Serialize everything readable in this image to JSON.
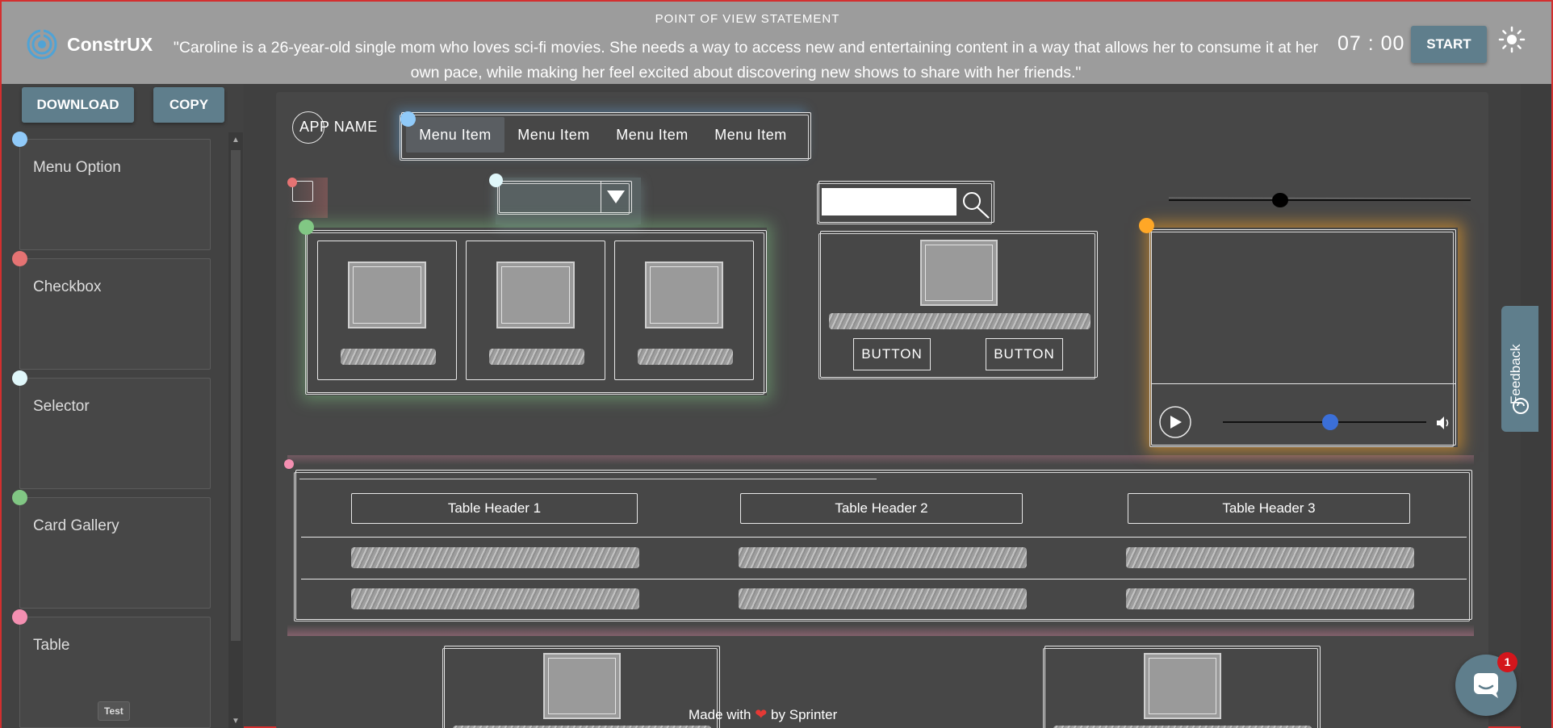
{
  "header": {
    "app_name": "ConstrUX",
    "pov_label": "POINT OF VIEW STATEMENT",
    "pov_text": "\"Caroline is a 26-year-old single mom who loves sci-fi movies. She needs a way to access new and entertaining content in a way that allows her to consume it at her own pace, while making her feel excited about discovering new shows to share with her friends.\"",
    "timer": "07 : 00",
    "start_label": "START",
    "theme_icon": "sun-icon"
  },
  "sidebar": {
    "download_label": "DOWNLOAD",
    "copy_label": "COPY",
    "components": [
      {
        "label": "Menu Option",
        "color": "#90caf9"
      },
      {
        "label": "Checkbox",
        "color": "#e57373"
      },
      {
        "label": "Selector",
        "color": "#e0f7fa"
      },
      {
        "label": "Card Gallery",
        "color": "#81c784"
      },
      {
        "label": "Table",
        "color": "#f48fb1"
      }
    ],
    "test_label": "Test"
  },
  "canvas": {
    "app_name": "APP NAME",
    "menu_items": [
      "Menu Item",
      "Menu Item",
      "Menu Item",
      "Menu Item"
    ],
    "buttons": [
      "BUTTON",
      "BUTTON"
    ],
    "table_headers": [
      "Table Header 1",
      "Table Header 2",
      "Table Header 3"
    ],
    "video_progress": 0.53,
    "slider_value": 0.36
  },
  "colors": {
    "menu_glow": "#64b5f6",
    "checkbox_glow": "#e57373",
    "selector_glow": "#b2ebf2",
    "gallery_glow": "#81c784",
    "video_glow": "#ffa726",
    "table_glow": "#f48fb1",
    "video_handle": "#3b6fd8"
  },
  "footer": {
    "made_with": "Made with",
    "by": "by Sprinter"
  },
  "widgets": {
    "feedback_label": "Feedback",
    "chat_badge": "1"
  }
}
